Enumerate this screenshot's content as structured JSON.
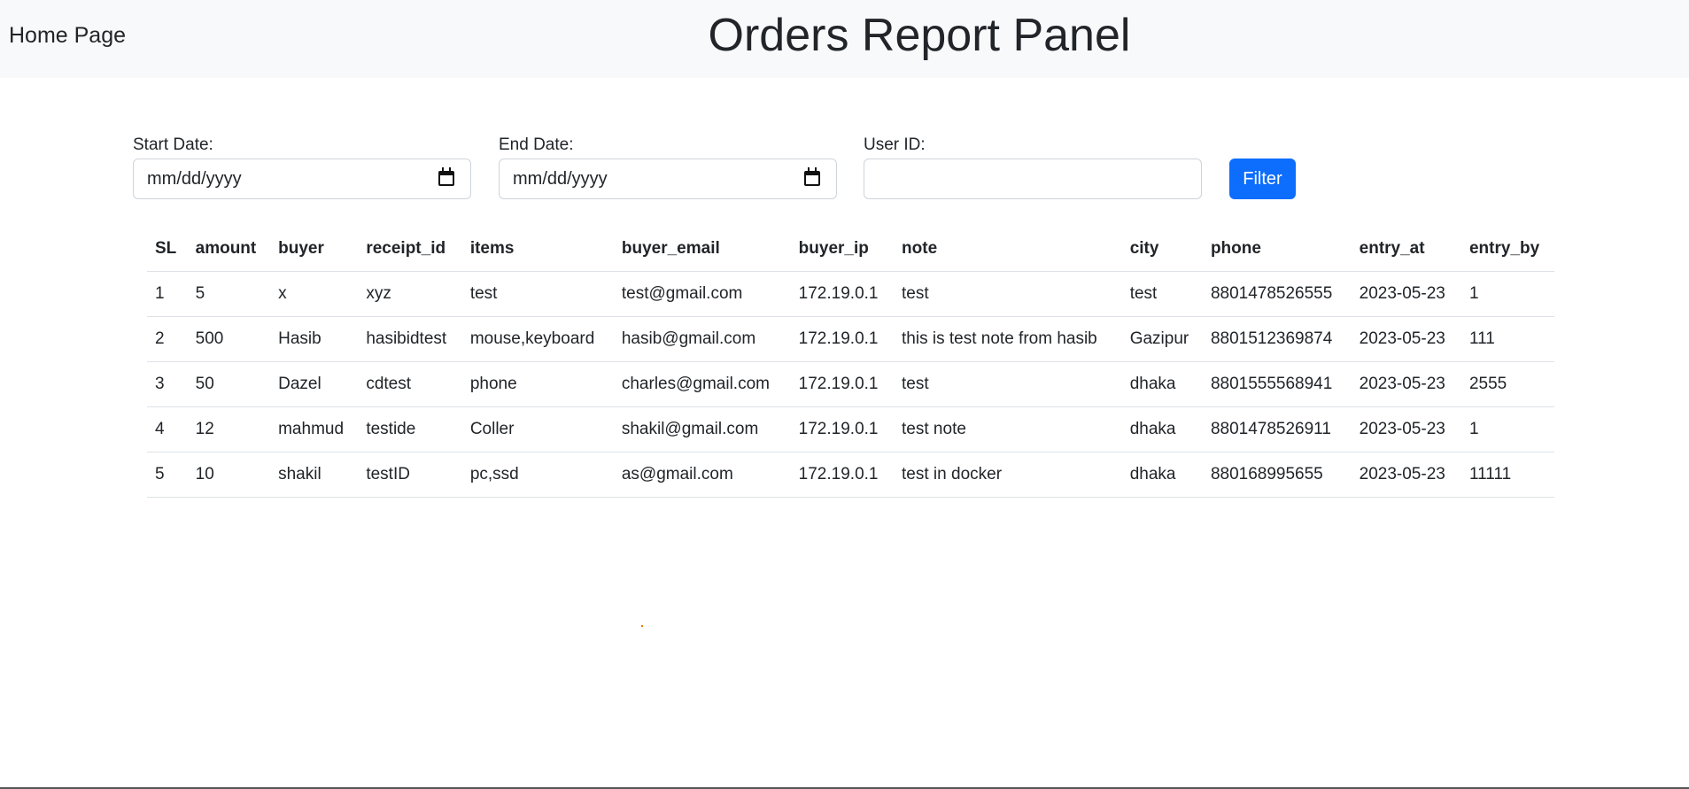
{
  "header": {
    "home_link": "Home Page",
    "title": "Orders Report Panel"
  },
  "filters": {
    "start_date": {
      "label": "Start Date:",
      "placeholder": "mm/dd/yyyy"
    },
    "end_date": {
      "label": "End Date:",
      "placeholder": "mm/dd/yyyy"
    },
    "user_id": {
      "label": "User ID:",
      "value": ""
    },
    "button_label": "Filter"
  },
  "colors": {
    "accent": "#0d6efd",
    "navbar_bg": "#f8f9fa"
  },
  "table": {
    "columns": [
      "SL",
      "amount",
      "buyer",
      "receipt_id",
      "items",
      "buyer_email",
      "buyer_ip",
      "note",
      "city",
      "phone",
      "entry_at",
      "entry_by"
    ],
    "rows": [
      [
        "1",
        "5",
        "x",
        "xyz",
        "test",
        "test@gmail.com",
        "172.19.0.1",
        "test",
        "test",
        "8801478526555",
        "2023-05-23",
        "1"
      ],
      [
        "2",
        "500",
        "Hasib",
        "hasibidtest",
        "mouse,keyboard",
        "hasib@gmail.com",
        "172.19.0.1",
        "this is test note from hasib",
        "Gazipur",
        "8801512369874",
        "2023-05-23",
        "111"
      ],
      [
        "3",
        "50",
        "Dazel",
        "cdtest",
        "phone",
        "charles@gmail.com",
        "172.19.0.1",
        "test",
        "dhaka",
        "8801555568941",
        "2023-05-23",
        "2555"
      ],
      [
        "4",
        "12",
        "mahmud",
        "testide",
        "Coller",
        "shakil@gmail.com",
        "172.19.0.1",
        "test note",
        "dhaka",
        "8801478526911",
        "2023-05-23",
        "1"
      ],
      [
        "5",
        "10",
        "shakil",
        "testID",
        "pc,ssd",
        "as@gmail.com",
        "172.19.0.1",
        "test in docker",
        "dhaka",
        "880168995655",
        "2023-05-23",
        "11111"
      ]
    ]
  }
}
